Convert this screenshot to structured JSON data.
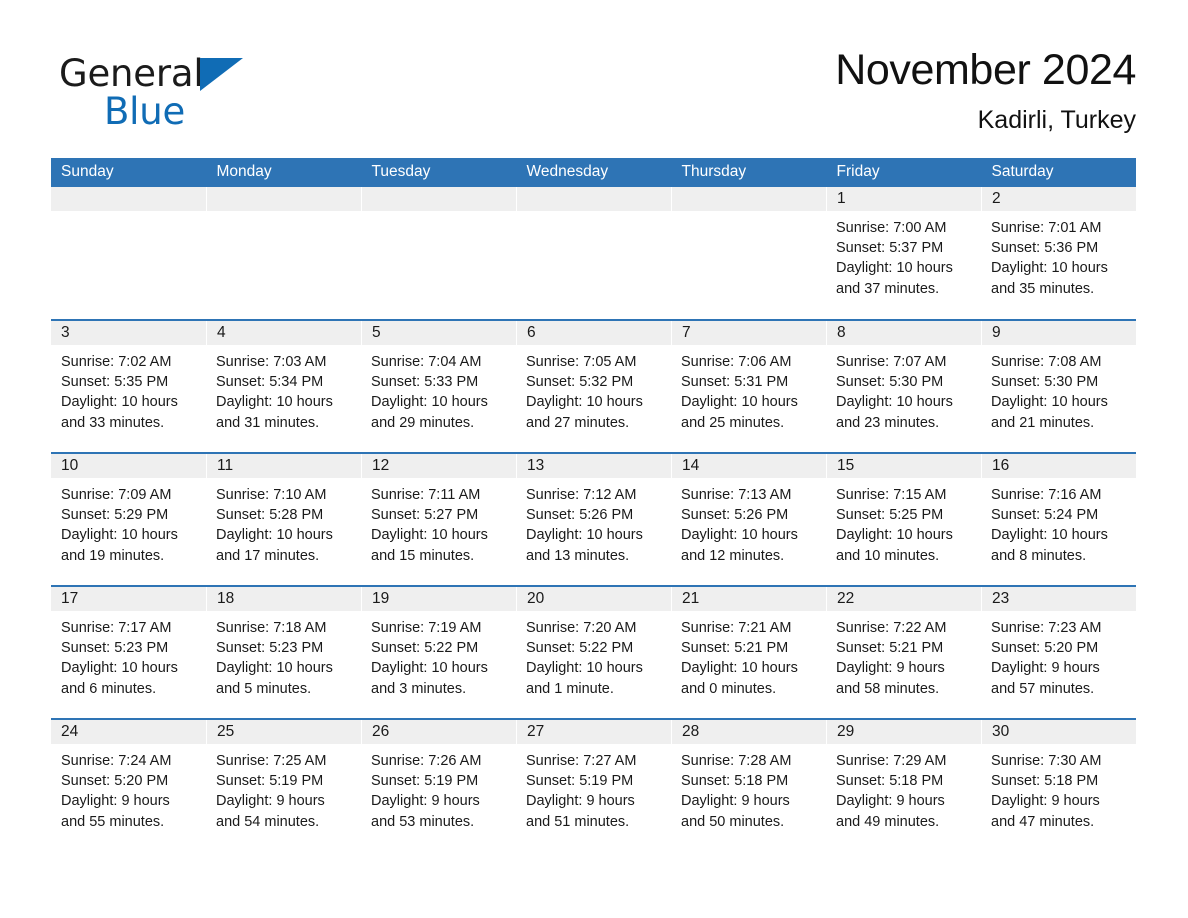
{
  "brand": {
    "name_part1": "General",
    "name_part2": "Blue",
    "logo_accent_color": "#106cb5"
  },
  "header": {
    "title": "November 2024",
    "location": "Kadirli, Turkey",
    "accent_color": "#2e74b5"
  },
  "calendar": {
    "weekday_headers": [
      "Sunday",
      "Monday",
      "Tuesday",
      "Wednesday",
      "Thursday",
      "Friday",
      "Saturday"
    ],
    "labels": {
      "sunrise": "Sunrise:",
      "sunset": "Sunset:",
      "daylight": "Daylight:"
    },
    "weeks": [
      [
        {
          "day": "",
          "empty": true
        },
        {
          "day": "",
          "empty": true
        },
        {
          "day": "",
          "empty": true
        },
        {
          "day": "",
          "empty": true
        },
        {
          "day": "",
          "empty": true
        },
        {
          "day": "1",
          "sunrise": "Sunrise: 7:00 AM",
          "sunset": "Sunset: 5:37 PM",
          "daylight": "Daylight: 10 hours and 37 minutes."
        },
        {
          "day": "2",
          "sunrise": "Sunrise: 7:01 AM",
          "sunset": "Sunset: 5:36 PM",
          "daylight": "Daylight: 10 hours and 35 minutes."
        }
      ],
      [
        {
          "day": "3",
          "sunrise": "Sunrise: 7:02 AM",
          "sunset": "Sunset: 5:35 PM",
          "daylight": "Daylight: 10 hours and 33 minutes."
        },
        {
          "day": "4",
          "sunrise": "Sunrise: 7:03 AM",
          "sunset": "Sunset: 5:34 PM",
          "daylight": "Daylight: 10 hours and 31 minutes."
        },
        {
          "day": "5",
          "sunrise": "Sunrise: 7:04 AM",
          "sunset": "Sunset: 5:33 PM",
          "daylight": "Daylight: 10 hours and 29 minutes."
        },
        {
          "day": "6",
          "sunrise": "Sunrise: 7:05 AM",
          "sunset": "Sunset: 5:32 PM",
          "daylight": "Daylight: 10 hours and 27 minutes."
        },
        {
          "day": "7",
          "sunrise": "Sunrise: 7:06 AM",
          "sunset": "Sunset: 5:31 PM",
          "daylight": "Daylight: 10 hours and 25 minutes."
        },
        {
          "day": "8",
          "sunrise": "Sunrise: 7:07 AM",
          "sunset": "Sunset: 5:30 PM",
          "daylight": "Daylight: 10 hours and 23 minutes."
        },
        {
          "day": "9",
          "sunrise": "Sunrise: 7:08 AM",
          "sunset": "Sunset: 5:30 PM",
          "daylight": "Daylight: 10 hours and 21 minutes."
        }
      ],
      [
        {
          "day": "10",
          "sunrise": "Sunrise: 7:09 AM",
          "sunset": "Sunset: 5:29 PM",
          "daylight": "Daylight: 10 hours and 19 minutes."
        },
        {
          "day": "11",
          "sunrise": "Sunrise: 7:10 AM",
          "sunset": "Sunset: 5:28 PM",
          "daylight": "Daylight: 10 hours and 17 minutes."
        },
        {
          "day": "12",
          "sunrise": "Sunrise: 7:11 AM",
          "sunset": "Sunset: 5:27 PM",
          "daylight": "Daylight: 10 hours and 15 minutes."
        },
        {
          "day": "13",
          "sunrise": "Sunrise: 7:12 AM",
          "sunset": "Sunset: 5:26 PM",
          "daylight": "Daylight: 10 hours and 13 minutes."
        },
        {
          "day": "14",
          "sunrise": "Sunrise: 7:13 AM",
          "sunset": "Sunset: 5:26 PM",
          "daylight": "Daylight: 10 hours and 12 minutes."
        },
        {
          "day": "15",
          "sunrise": "Sunrise: 7:15 AM",
          "sunset": "Sunset: 5:25 PM",
          "daylight": "Daylight: 10 hours and 10 minutes."
        },
        {
          "day": "16",
          "sunrise": "Sunrise: 7:16 AM",
          "sunset": "Sunset: 5:24 PM",
          "daylight": "Daylight: 10 hours and 8 minutes."
        }
      ],
      [
        {
          "day": "17",
          "sunrise": "Sunrise: 7:17 AM",
          "sunset": "Sunset: 5:23 PM",
          "daylight": "Daylight: 10 hours and 6 minutes."
        },
        {
          "day": "18",
          "sunrise": "Sunrise: 7:18 AM",
          "sunset": "Sunset: 5:23 PM",
          "daylight": "Daylight: 10 hours and 5 minutes."
        },
        {
          "day": "19",
          "sunrise": "Sunrise: 7:19 AM",
          "sunset": "Sunset: 5:22 PM",
          "daylight": "Daylight: 10 hours and 3 minutes."
        },
        {
          "day": "20",
          "sunrise": "Sunrise: 7:20 AM",
          "sunset": "Sunset: 5:22 PM",
          "daylight": "Daylight: 10 hours and 1 minute."
        },
        {
          "day": "21",
          "sunrise": "Sunrise: 7:21 AM",
          "sunset": "Sunset: 5:21 PM",
          "daylight": "Daylight: 10 hours and 0 minutes."
        },
        {
          "day": "22",
          "sunrise": "Sunrise: 7:22 AM",
          "sunset": "Sunset: 5:21 PM",
          "daylight": "Daylight: 9 hours and 58 minutes."
        },
        {
          "day": "23",
          "sunrise": "Sunrise: 7:23 AM",
          "sunset": "Sunset: 5:20 PM",
          "daylight": "Daylight: 9 hours and 57 minutes."
        }
      ],
      [
        {
          "day": "24",
          "sunrise": "Sunrise: 7:24 AM",
          "sunset": "Sunset: 5:20 PM",
          "daylight": "Daylight: 9 hours and 55 minutes."
        },
        {
          "day": "25",
          "sunrise": "Sunrise: 7:25 AM",
          "sunset": "Sunset: 5:19 PM",
          "daylight": "Daylight: 9 hours and 54 minutes."
        },
        {
          "day": "26",
          "sunrise": "Sunrise: 7:26 AM",
          "sunset": "Sunset: 5:19 PM",
          "daylight": "Daylight: 9 hours and 53 minutes."
        },
        {
          "day": "27",
          "sunrise": "Sunrise: 7:27 AM",
          "sunset": "Sunset: 5:19 PM",
          "daylight": "Daylight: 9 hours and 51 minutes."
        },
        {
          "day": "28",
          "sunrise": "Sunrise: 7:28 AM",
          "sunset": "Sunset: 5:18 PM",
          "daylight": "Daylight: 9 hours and 50 minutes."
        },
        {
          "day": "29",
          "sunrise": "Sunrise: 7:29 AM",
          "sunset": "Sunset: 5:18 PM",
          "daylight": "Daylight: 9 hours and 49 minutes."
        },
        {
          "day": "30",
          "sunrise": "Sunrise: 7:30 AM",
          "sunset": "Sunset: 5:18 PM",
          "daylight": "Daylight: 9 hours and 47 minutes."
        }
      ]
    ]
  }
}
